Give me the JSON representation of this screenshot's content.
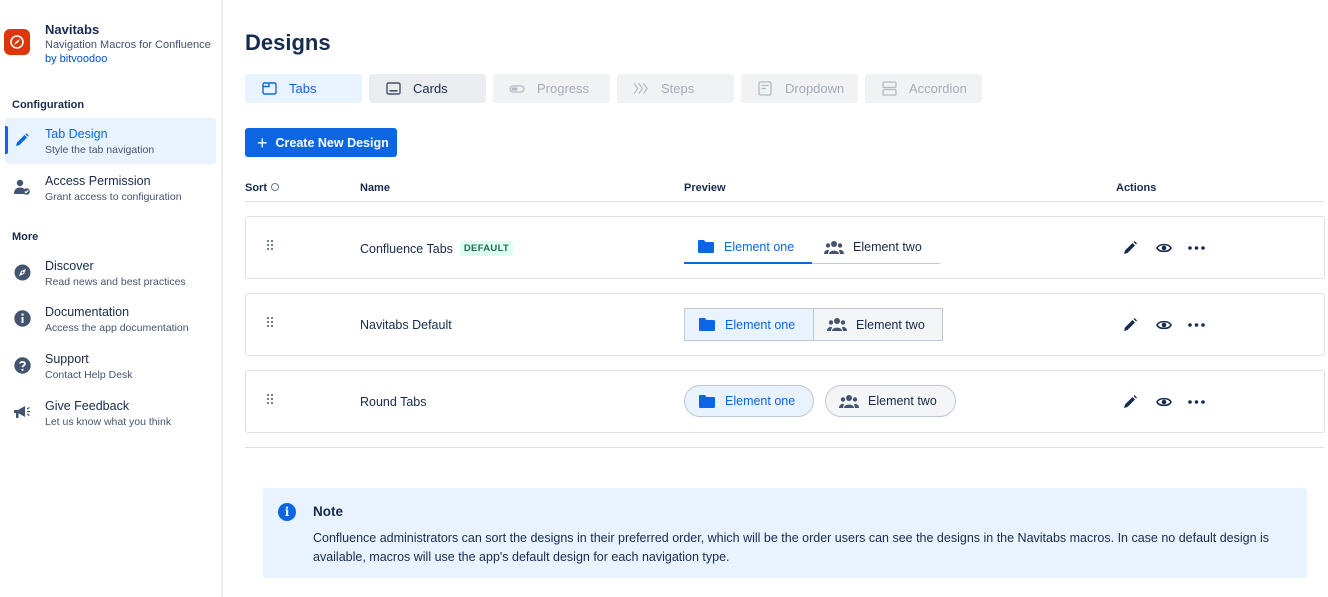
{
  "sidebar": {
    "app_name": "Navitabs",
    "app_subtitle": "Navigation Macros for Confluence",
    "app_vendor": "by bitvoodoo",
    "config_label": "Configuration",
    "more_label": "More",
    "config_items": [
      {
        "title": "Tab Design",
        "desc": "Style the tab navigation",
        "icon": "pencil-icon",
        "active": true
      },
      {
        "title": "Access Permission",
        "desc": "Grant access to configuration",
        "icon": "user-check-icon"
      }
    ],
    "more_items": [
      {
        "title": "Discover",
        "desc": "Read news and best practices",
        "icon": "compass-icon"
      },
      {
        "title": "Documentation",
        "desc": "Access the app documentation",
        "icon": "info-icon"
      },
      {
        "title": "Support",
        "desc": "Contact Help Desk",
        "icon": "question-icon"
      },
      {
        "title": "Give Feedback",
        "desc": "Let us know what you think",
        "icon": "megaphone-icon"
      }
    ]
  },
  "main": {
    "title": "Designs",
    "tabs": [
      {
        "label": "Tabs",
        "icon": "tabs-icon",
        "state": "selected"
      },
      {
        "label": "Cards",
        "icon": "cards-icon",
        "state": "enabled"
      },
      {
        "label": "Progress",
        "icon": "progress-icon",
        "state": "disabled"
      },
      {
        "label": "Steps",
        "icon": "steps-icon",
        "state": "disabled"
      },
      {
        "label": "Dropdown",
        "icon": "dropdown-icon",
        "state": "disabled"
      },
      {
        "label": "Accordion",
        "icon": "accordion-icon",
        "state": "disabled"
      }
    ],
    "create_button": "Create New Design",
    "columns": {
      "sort": "Sort",
      "name": "Name",
      "preview": "Preview",
      "actions": "Actions"
    },
    "rows": [
      {
        "name": "Confluence Tabs",
        "badge": "DEFAULT",
        "style": "underline",
        "el1": "Element one",
        "el2": "Element two"
      },
      {
        "name": "Navitabs Default",
        "badge": "",
        "style": "boxed",
        "el1": "Element one",
        "el2": "Element two"
      },
      {
        "name": "Round Tabs",
        "badge": "",
        "style": "round",
        "el1": "Element one",
        "el2": "Element two"
      }
    ]
  },
  "note": {
    "title": "Note",
    "body": "Confluence administrators can sort the designs in their preferred order, which will be the order users can see the designs in the Navitabs macros. In case no default design is available, macros will use the app's default design for each navigation type."
  },
  "colors": {
    "accent": "#0c66e4",
    "logo": "#de350b",
    "note_bg": "#e9f2ff",
    "badge_bg": "#dcfff1",
    "badge_fg": "#216e4e"
  }
}
